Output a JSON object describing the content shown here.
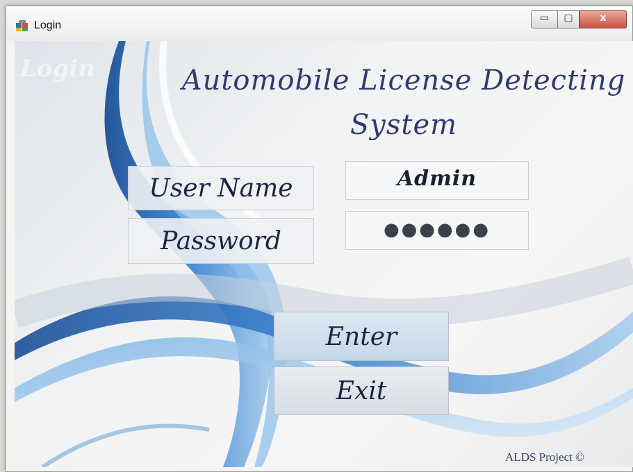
{
  "window": {
    "title": "Login",
    "controls": {
      "minimize": "▭",
      "maximize": "▢",
      "close": "x"
    }
  },
  "watermark": "Login",
  "app": {
    "title": "Automobile License Detecting System"
  },
  "form": {
    "username_label": "User Name",
    "username_value": "Admin",
    "password_label": "Password",
    "password_value": "●●●●●●"
  },
  "buttons": {
    "enter": "Enter",
    "exit": "Exit"
  },
  "footer": "ALDS Project ©",
  "colors": {
    "accent_blue": "#2f6fb6",
    "title_text": "#2f3b6e"
  }
}
